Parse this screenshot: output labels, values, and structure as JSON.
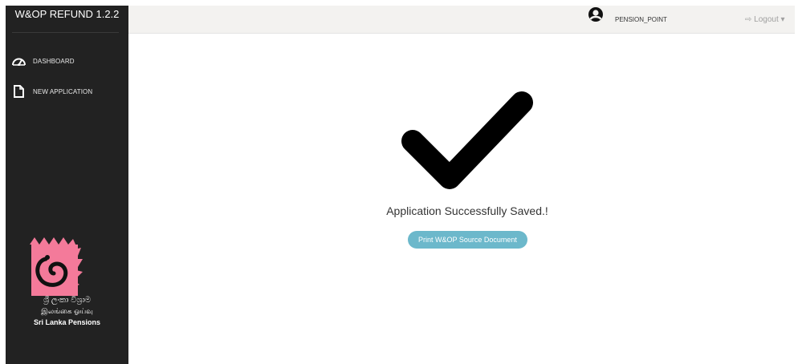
{
  "app": {
    "title": "W&OP REFUND 1.2.2"
  },
  "sidebar": {
    "items": [
      {
        "label": "DASHBOARD",
        "icon": "dashboard-gauge-icon"
      },
      {
        "label": "NEW APPLICATION",
        "icon": "document-icon"
      }
    ],
    "logo": {
      "line1": "ශ්‍රී ලංකා විශ්‍රාම",
      "line2": "இலங்கை ஓய்வு",
      "line3": "Sri Lanka Pensions"
    }
  },
  "header": {
    "user": "PENSION_POINT",
    "user_icon": "user-circle-icon",
    "logout_label": "Logout",
    "logout_icon": "sign-out-icon"
  },
  "main": {
    "status_icon": "checkmark-icon",
    "message": "Application Successfully Saved.!",
    "print_button": "Print W&OP Source Document"
  },
  "colors": {
    "sidebar_bg": "#222222",
    "header_bg": "#f3f2f0",
    "button_bg": "#6cb8cb",
    "logo_pink": "#f47a9a"
  }
}
